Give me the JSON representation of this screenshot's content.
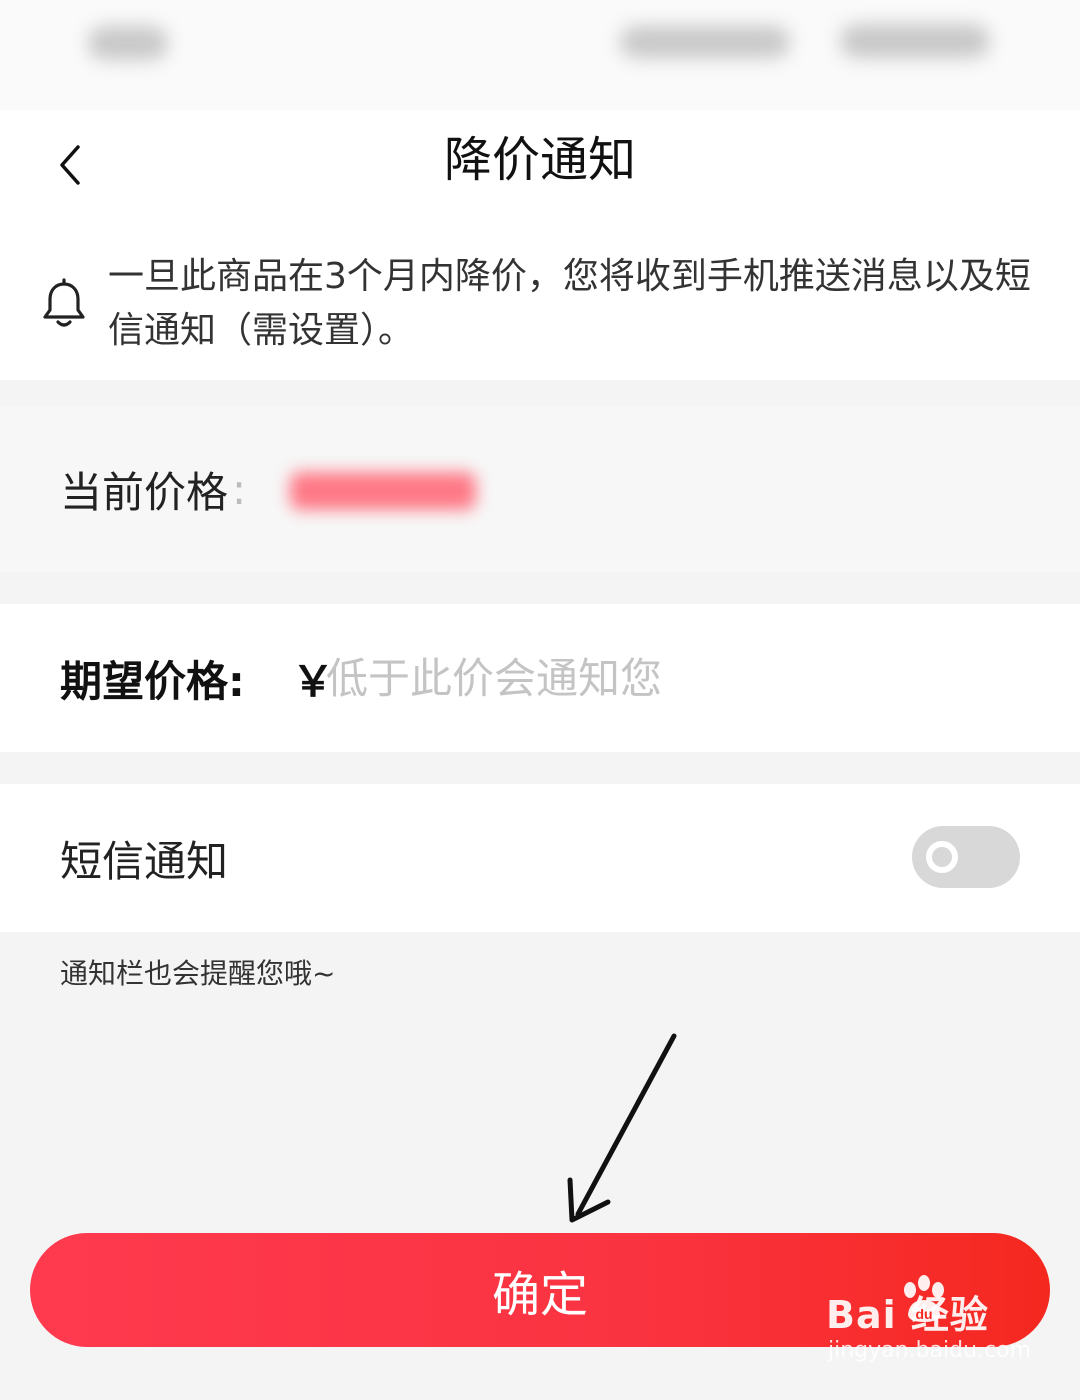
{
  "header": {
    "title": "降价通知"
  },
  "notice": {
    "text": "一旦此商品在3个月内降价，您将收到手机推送消息以及短信通知（需设置）。"
  },
  "current_price": {
    "label": "当前价格",
    "colon": ":"
  },
  "expected_price": {
    "label": "期望价格:",
    "currency": "￥",
    "value": "",
    "placeholder": "低于此价会通知您"
  },
  "sms": {
    "label": "短信通知",
    "enabled": false
  },
  "hint": "通知栏也会提醒您哦~",
  "confirm": {
    "label": "确定"
  },
  "watermark": {
    "main": "Bai  经验",
    "sub": "jingyan.baidu.com"
  },
  "colors": {
    "accent": "#fa3340",
    "toggle_off": "#d8d8d8",
    "placeholder": "#c4c4c4",
    "background": "#f4f4f4"
  },
  "icons": {
    "back": "chevron-left-icon",
    "bell": "bell-icon",
    "paw": "paw-icon"
  }
}
